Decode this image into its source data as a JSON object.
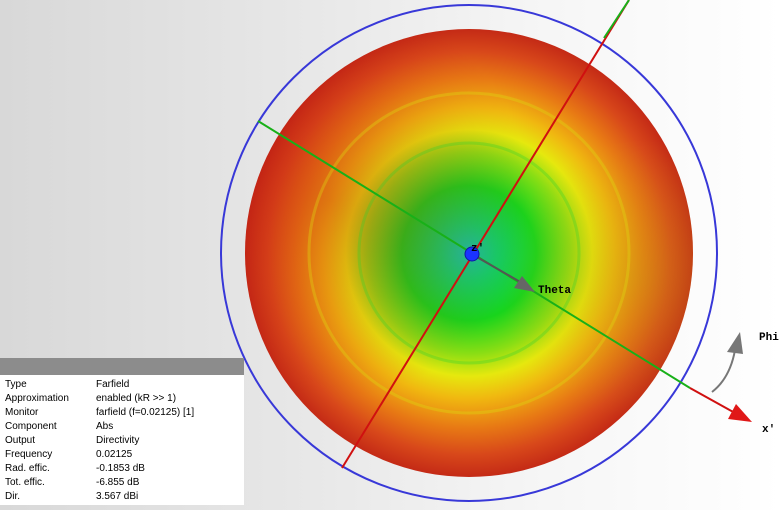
{
  "view": {
    "center_label": "z'",
    "theta_label": "Theta",
    "phi_label": "Phi",
    "x_label": "x'"
  },
  "colors": {
    "outer_ring": "#3a3ad6",
    "center_marker": "#1a33ff",
    "axis_red": "#d01010",
    "axis_green": "#18b018",
    "arrow_grey": "#666666",
    "pattern_edge": "#c41c12",
    "pattern_mid": "#e8e80c",
    "pattern_center": "#12c8a0"
  },
  "info": {
    "rows": [
      {
        "key": "Type",
        "value": "Farfield"
      },
      {
        "key": "Approximation",
        "value": "enabled (kR >> 1)"
      },
      {
        "key": "Monitor",
        "value": "farfield (f=0.02125) [1]"
      },
      {
        "key": "Component",
        "value": "Abs"
      },
      {
        "key": "Output",
        "value": "Directivity"
      },
      {
        "key": "Frequency",
        "value": "0.02125"
      },
      {
        "key": "Rad. effic.",
        "value": "-0.1853 dB"
      },
      {
        "key": "Tot. effic.",
        "value": "-6.855 dB"
      },
      {
        "key": "Dir.",
        "value": "3.567 dBi"
      }
    ]
  }
}
